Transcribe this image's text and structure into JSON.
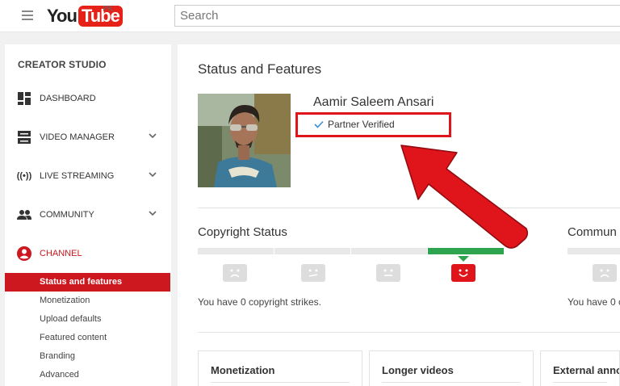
{
  "header": {
    "logo_you": "You",
    "logo_tube": "Tube",
    "logo_region": "PK",
    "search_placeholder": "Search"
  },
  "sidebar": {
    "title": "CREATOR STUDIO",
    "items": [
      {
        "label": "DASHBOARD",
        "icon": "dashboard-icon",
        "expandable": false
      },
      {
        "label": "VIDEO MANAGER",
        "icon": "video-manager-icon",
        "expandable": true
      },
      {
        "label": "LIVE STREAMING",
        "icon": "live-streaming-icon",
        "expandable": true
      },
      {
        "label": "COMMUNITY",
        "icon": "community-icon",
        "expandable": true
      },
      {
        "label": "CHANNEL",
        "icon": "channel-icon",
        "expandable": false,
        "active": true
      }
    ],
    "channel_subitems": [
      {
        "label": "Status and features",
        "active": true
      },
      {
        "label": "Monetization"
      },
      {
        "label": "Upload defaults"
      },
      {
        "label": "Featured content"
      },
      {
        "label": "Branding"
      },
      {
        "label": "Advanced"
      }
    ]
  },
  "main": {
    "title": "Status and Features",
    "user_name": "Aamir Saleem Ansari",
    "verified_label": "Partner Verified",
    "copyright": {
      "title": "Copyright Status",
      "strikes_text": "You have 0 copyright strikes."
    },
    "community": {
      "title": "Commun",
      "strikes_text": "You have 0 c"
    },
    "cards": [
      {
        "title": "Monetization"
      },
      {
        "title": "Longer videos"
      },
      {
        "title": "External anno"
      }
    ]
  },
  "colors": {
    "accent": "#cc181e",
    "annotation": "#e0141b",
    "good_status": "#2ea44f"
  }
}
